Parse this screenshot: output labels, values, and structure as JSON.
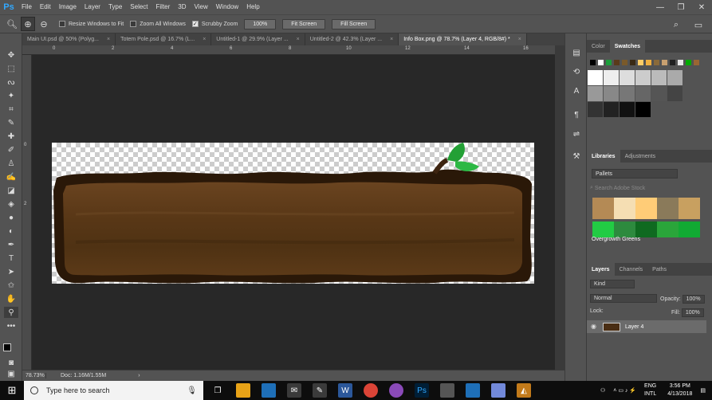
{
  "app": {
    "logo": "Ps",
    "menus": [
      "File",
      "Edit",
      "Image",
      "Layer",
      "Type",
      "Select",
      "Filter",
      "3D",
      "View",
      "Window",
      "Help"
    ],
    "window_controls": [
      "—",
      "❐",
      "✕"
    ]
  },
  "options_bar": {
    "resize_windows": "Resize Windows to Fit",
    "zoom_all": "Zoom All Windows",
    "scrubby_zoom": "Scrubby Zoom",
    "zoom_value": "100%",
    "fit_screen": "Fit Screen",
    "fill_screen": "Fill Screen"
  },
  "tabs": [
    {
      "label": "Main UI.psd @ 50% (Polyg...",
      "active": false
    },
    {
      "label": "Totem Pole.psd @ 16.7% (L...",
      "active": false
    },
    {
      "label": "Untitled-1 @ 29.9% (Layer ...",
      "active": false
    },
    {
      "label": "Untitled-2 @ 42.3% (Layer ...",
      "active": false
    },
    {
      "label": "Info Box.png @ 78.7% (Layer 4, RGB/8#) *",
      "active": true
    }
  ],
  "tab_close": "×",
  "ruler": {
    "top": [
      "0",
      "2",
      "4",
      "6",
      "8",
      "10",
      "12",
      "14",
      "16"
    ],
    "left": [
      "0",
      "2"
    ]
  },
  "status": {
    "zoom": "78.73%",
    "doc": "Doc: 1.16M/1.55M",
    "arrow": "›"
  },
  "panels": {
    "color_tab": "Color",
    "swatches_tab": "Swatches",
    "libraries_tab": "Libraries",
    "adjustments_tab": "Adjustments",
    "library_select": "Pallets",
    "search_placeholder": "Search Adobe Stock",
    "group_label": "Overgrowth Greens",
    "layers_tab": "Layers",
    "channels_tab": "Channels",
    "paths_tab": "Paths",
    "kind": "Kind",
    "blend_mode": "Normal",
    "opacity_label": "Opacity:",
    "opacity": "100%",
    "lock_label": "Lock:",
    "fill_label": "Fill:",
    "fill": "100%",
    "layer_name": "Layer 4"
  },
  "swatch_colors": {
    "top_row": [
      "#000000",
      "#ffffff",
      "#1b9e3a",
      "#5a3a1a",
      "#7a5a2a",
      "#3a2a14",
      "#ffcc66",
      "#f0b040",
      "#8a6a3a",
      "#c8a070",
      "#202020",
      "#e8e8e8",
      "#00aa00",
      "#996633"
    ],
    "grays": [
      "#ffffff",
      "#eeeeee",
      "#dddddd",
      "#cccccc",
      "#bbbbbb",
      "#aaaaaa",
      "#999999",
      "#888888",
      "#777777",
      "#666666",
      "#555555",
      "#444444",
      "#333333",
      "#222222",
      "#111111",
      "#000000"
    ],
    "pallet_row1": [
      "#b48a55",
      "#f5deb3",
      "#ffcc77",
      "#8a7a5a",
      "#c8a060"
    ],
    "pallet_row2": [
      "#22cc44",
      "#2d8a3e",
      "#0f6a20",
      "#2aa53a",
      "#11aa33"
    ]
  },
  "taskbar": {
    "search": "Type here to search",
    "lang1": "ENG",
    "lang2": "INTL",
    "time": "3:56 PM",
    "date": "4/13/2018"
  }
}
